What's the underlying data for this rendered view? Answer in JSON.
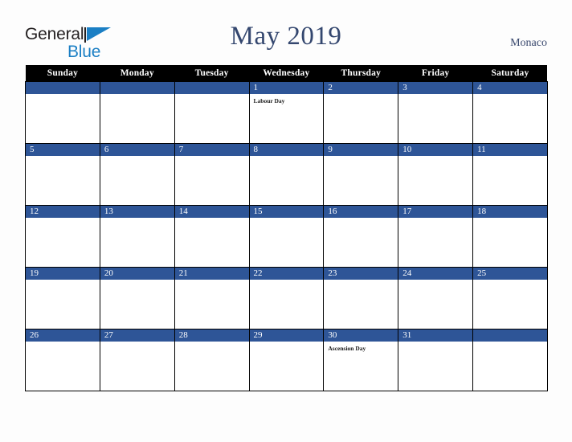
{
  "brand": {
    "name_part1": "General",
    "name_part2": "Blue",
    "flag_icon": "blue-triangle-flag-icon",
    "colors": {
      "dark": "#231f20",
      "blue": "#1b7fc4"
    }
  },
  "header": {
    "title": "May 2019",
    "month": "May",
    "year": "2019",
    "locale": "Monaco",
    "title_color": "#34476f",
    "locale_color": "#36456b"
  },
  "calendar": {
    "weekday_headers": [
      "Sunday",
      "Monday",
      "Tuesday",
      "Wednesday",
      "Thursday",
      "Friday",
      "Saturday"
    ],
    "header_bg": "#000000",
    "header_text": "#ffffff",
    "day_band_bg": "#2e5597",
    "day_band_text": "#ffffff",
    "cell_bg": "#ffffff",
    "grid_line": "#000000",
    "weeks": [
      [
        {
          "date": "",
          "events": []
        },
        {
          "date": "",
          "events": []
        },
        {
          "date": "",
          "events": []
        },
        {
          "date": "1",
          "events": [
            "Labour Day"
          ]
        },
        {
          "date": "2",
          "events": []
        },
        {
          "date": "3",
          "events": []
        },
        {
          "date": "4",
          "events": []
        }
      ],
      [
        {
          "date": "5",
          "events": []
        },
        {
          "date": "6",
          "events": []
        },
        {
          "date": "7",
          "events": []
        },
        {
          "date": "8",
          "events": []
        },
        {
          "date": "9",
          "events": []
        },
        {
          "date": "10",
          "events": []
        },
        {
          "date": "11",
          "events": []
        }
      ],
      [
        {
          "date": "12",
          "events": []
        },
        {
          "date": "13",
          "events": []
        },
        {
          "date": "14",
          "events": []
        },
        {
          "date": "15",
          "events": []
        },
        {
          "date": "16",
          "events": []
        },
        {
          "date": "17",
          "events": []
        },
        {
          "date": "18",
          "events": []
        }
      ],
      [
        {
          "date": "19",
          "events": []
        },
        {
          "date": "20",
          "events": []
        },
        {
          "date": "21",
          "events": []
        },
        {
          "date": "22",
          "events": []
        },
        {
          "date": "23",
          "events": []
        },
        {
          "date": "24",
          "events": []
        },
        {
          "date": "25",
          "events": []
        }
      ],
      [
        {
          "date": "26",
          "events": []
        },
        {
          "date": "27",
          "events": []
        },
        {
          "date": "28",
          "events": []
        },
        {
          "date": "29",
          "events": []
        },
        {
          "date": "30",
          "events": [
            "Ascension Day"
          ]
        },
        {
          "date": "31",
          "events": []
        },
        {
          "date": "",
          "events": []
        }
      ]
    ]
  }
}
